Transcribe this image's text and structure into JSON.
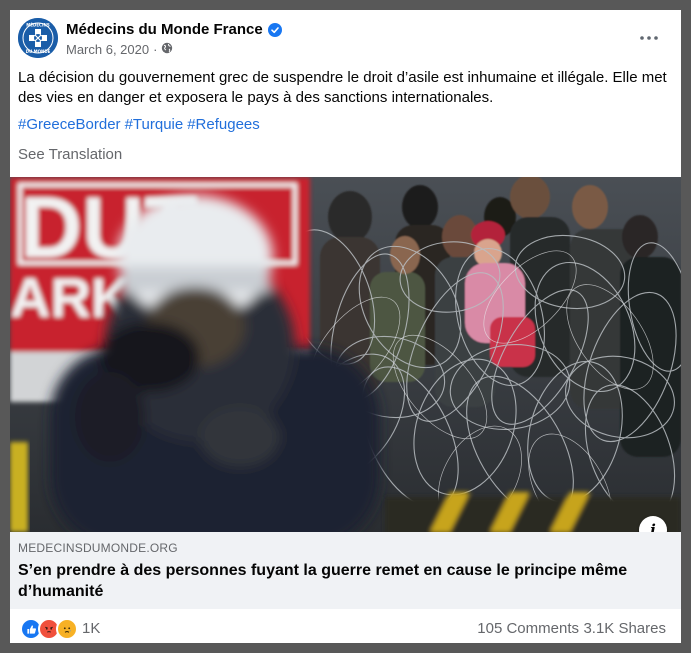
{
  "post": {
    "page_name": "Médecins du Monde France",
    "date": "March 6, 2020",
    "visibility_separator": "·",
    "text": "La décision du gouvernement grec de suspendre le droit d’asile est inhumaine et illégale. Elle met des vies en danger et exposera le pays à des sanctions internationales.",
    "hashtags": [
      "#GreeceBorder",
      "#Turquie",
      "#Refugees"
    ],
    "see_translation": "See Translation"
  },
  "avatar": {
    "logo_text_top": "MÉDECINS",
    "logo_text_bottom": "DU MONDE"
  },
  "link": {
    "domain": "MEDECINSDUMONDE.ORG",
    "headline": "S’en prendre à des personnes fuyant la guerre remet en cause le principe même d’humanité",
    "info_label": "i"
  },
  "photo": {
    "sign_text": "DUT",
    "sign_text_2": "ARKI"
  },
  "stats": {
    "reactions_count": "1K",
    "comments": "105 Comments",
    "shares": "3.1K Shares"
  },
  "icons": {
    "verified": "verified-badge-icon",
    "globe": "globe-icon",
    "more": "more-options-icon",
    "like": "like-reaction-icon",
    "angry": "angry-reaction-icon",
    "sad": "sad-reaction-icon"
  },
  "colors": {
    "link_blue": "#216fdb",
    "verified_blue": "#1877f2",
    "avatar_blue": "#1a5da8",
    "sign_red": "#c8212e"
  }
}
